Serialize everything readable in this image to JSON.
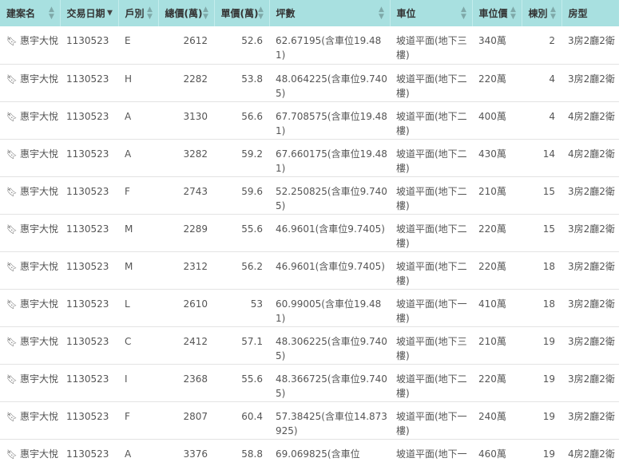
{
  "columns": [
    "建案名",
    "交易日期",
    "戶別",
    "總價(萬)",
    "單價(萬)",
    "坪數",
    "車位",
    "車位價",
    "棟別",
    "房型"
  ],
  "rows": [
    {
      "name": "惠宇大悅",
      "date": "1130523",
      "unit": "E",
      "total": "2612",
      "price": "52.6",
      "area": "62.67195(含車位19.481)",
      "parking": "坡道平面(地下三樓)",
      "parking_price": "340萬",
      "building": "2",
      "layout": "3房2廳2衛"
    },
    {
      "name": "惠宇大悅",
      "date": "1130523",
      "unit": "H",
      "total": "2282",
      "price": "53.8",
      "area": "48.064225(含車位9.7405)",
      "parking": "坡道平面(地下二樓)",
      "parking_price": "220萬",
      "building": "4",
      "layout": "3房2廳2衛"
    },
    {
      "name": "惠宇大悅",
      "date": "1130523",
      "unit": "A",
      "total": "3130",
      "price": "56.6",
      "area": "67.708575(含車位19.481)",
      "parking": "坡道平面(地下二樓)",
      "parking_price": "400萬",
      "building": "4",
      "layout": "4房2廳2衛"
    },
    {
      "name": "惠宇大悅",
      "date": "1130523",
      "unit": "A",
      "total": "3282",
      "price": "59.2",
      "area": "67.660175(含車位19.481)",
      "parking": "坡道平面(地下二樓)",
      "parking_price": "430萬",
      "building": "14",
      "layout": "4房2廳2衛"
    },
    {
      "name": "惠宇大悅",
      "date": "1130523",
      "unit": "F",
      "total": "2743",
      "price": "59.6",
      "area": "52.250825(含車位9.7405)",
      "parking": "坡道平面(地下二樓)",
      "parking_price": "210萬",
      "building": "15",
      "layout": "3房2廳2衛"
    },
    {
      "name": "惠宇大悅",
      "date": "1130523",
      "unit": "M",
      "total": "2289",
      "price": "55.6",
      "area": "46.9601(含車位9.7405)",
      "parking": "坡道平面(地下二樓)",
      "parking_price": "220萬",
      "building": "15",
      "layout": "3房2廳2衛"
    },
    {
      "name": "惠宇大悅",
      "date": "1130523",
      "unit": "M",
      "total": "2312",
      "price": "56.2",
      "area": "46.9601(含車位9.7405)",
      "parking": "坡道平面(地下二樓)",
      "parking_price": "220萬",
      "building": "18",
      "layout": "3房2廳2衛"
    },
    {
      "name": "惠宇大悅",
      "date": "1130523",
      "unit": "L",
      "total": "2610",
      "price": "53",
      "area": "60.99005(含車位19.481)",
      "parking": "坡道平面(地下一樓)",
      "parking_price": "410萬",
      "building": "18",
      "layout": "3房2廳2衛"
    },
    {
      "name": "惠宇大悅",
      "date": "1130523",
      "unit": "C",
      "total": "2412",
      "price": "57.1",
      "area": "48.306225(含車位9.7405)",
      "parking": "坡道平面(地下三樓)",
      "parking_price": "210萬",
      "building": "19",
      "layout": "3房2廳2衛"
    },
    {
      "name": "惠宇大悅",
      "date": "1130523",
      "unit": "I",
      "total": "2368",
      "price": "55.6",
      "area": "48.366725(含車位9.7405)",
      "parking": "坡道平面(地下二樓)",
      "parking_price": "220萬",
      "building": "19",
      "layout": "3房2廳2衛"
    },
    {
      "name": "惠宇大悅",
      "date": "1130523",
      "unit": "F",
      "total": "2807",
      "price": "60.4",
      "area": "57.38425(含車位14.873925)",
      "parking": "坡道平面(地下一樓)",
      "parking_price": "240萬",
      "building": "19",
      "layout": "3房2廳2衛"
    },
    {
      "name": "惠宇大悅",
      "date": "1130523",
      "unit": "A",
      "total": "3376",
      "price": "58.8",
      "area": "69.069825(含車位",
      "parking": "坡道平面(地下一樓)",
      "parking_price": "460萬",
      "building": "19",
      "layout": "4房2廳2衛"
    }
  ],
  "bookmark_icon": "bookmark-icon",
  "sort": {
    "active_column": 1,
    "direction": "desc"
  },
  "colors": {
    "header_bg": "#a8e0e0",
    "text": "#555555",
    "row_border": "#e3e3e3"
  }
}
